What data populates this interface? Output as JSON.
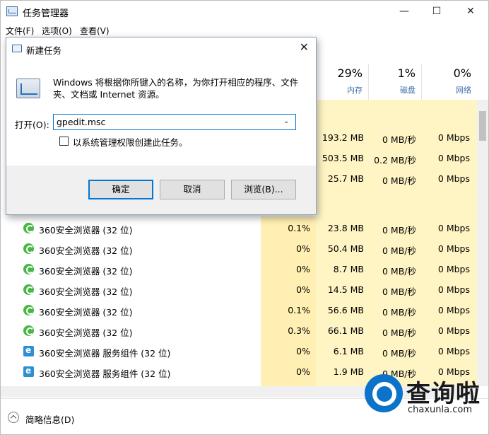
{
  "window": {
    "title": "任务管理器",
    "minimize": "—",
    "maximize": "☐",
    "close": "✕"
  },
  "menu": [
    "文件(F)",
    "选项(O)",
    "查看(V)"
  ],
  "columns": [
    {
      "pct": "29%",
      "label": "内存"
    },
    {
      "pct": "1%",
      "label": "磁盘"
    },
    {
      "pct": "0%",
      "label": "网络"
    }
  ],
  "rows_partial": [
    {
      "memory": "193.2 MB",
      "disk": "0 MB/秒",
      "network": "0 Mbps"
    },
    {
      "memory": "503.5 MB",
      "disk": "0.2 MB/秒",
      "network": "0 Mbps"
    },
    {
      "memory": "25.7 MB",
      "disk": "0 MB/秒",
      "network": "0 Mbps"
    }
  ],
  "rows": [
    {
      "name": "360安全浏览器 (32 位)",
      "icon": "browser-icon",
      "cpu": "0.1%",
      "memory": "23.8 MB",
      "disk": "0 MB/秒",
      "network": "0 Mbps"
    },
    {
      "name": "360安全浏览器 (32 位)",
      "icon": "browser-icon",
      "cpu": "0%",
      "memory": "50.4 MB",
      "disk": "0 MB/秒",
      "network": "0 Mbps"
    },
    {
      "name": "360安全浏览器 (32 位)",
      "icon": "browser-icon",
      "cpu": "0%",
      "memory": "8.7 MB",
      "disk": "0 MB/秒",
      "network": "0 Mbps"
    },
    {
      "name": "360安全浏览器 (32 位)",
      "icon": "browser-icon",
      "cpu": "0%",
      "memory": "14.5 MB",
      "disk": "0 MB/秒",
      "network": "0 Mbps"
    },
    {
      "name": "360安全浏览器 (32 位)",
      "icon": "browser-icon",
      "cpu": "0.1%",
      "memory": "56.6 MB",
      "disk": "0 MB/秒",
      "network": "0 Mbps"
    },
    {
      "name": "360安全浏览器 (32 位)",
      "icon": "browser-icon",
      "cpu": "0.3%",
      "memory": "66.1 MB",
      "disk": "0 MB/秒",
      "network": "0 Mbps"
    },
    {
      "name": "360安全浏览器 服务组件 (32 位)",
      "icon": "service-icon",
      "cpu": "0%",
      "memory": "6.1 MB",
      "disk": "0 MB/秒",
      "network": "0 Mbps"
    },
    {
      "name": "360安全浏览器 服务组件 (32 位)",
      "icon": "service-icon",
      "cpu": "0%",
      "memory": "1.9 MB",
      "disk": "0 MB/秒",
      "network": "0 Mbps"
    }
  ],
  "footer": {
    "fewer_details": "简略信息(D)"
  },
  "dialog": {
    "title": "新建任务",
    "close": "✕",
    "description": "Windows 将根据你所键入的名称，为你打开相应的程序、文件夹、文档或 Internet 资源。",
    "open_label": "打开(O):",
    "open_value": "gpedit.msc",
    "admin_checkbox_label": "以系统管理权限创建此任务。",
    "admin_checked": false,
    "ok": "确定",
    "cancel": "取消",
    "browse": "浏览(B)..."
  },
  "watermark": {
    "text": "查询啦",
    "url": "chaxunla.com"
  },
  "colors": {
    "accent": "#0078d7",
    "cell_shade": "#fff4c4",
    "header_label": "#3a6ea8"
  }
}
